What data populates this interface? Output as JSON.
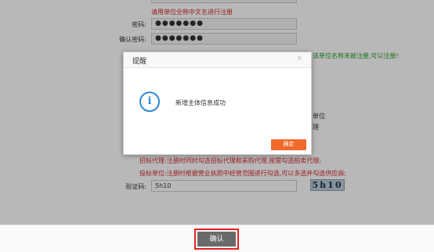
{
  "form": {
    "name_hint": "请用单位全称中文名进行注册",
    "password_label": "密码:",
    "password_value": "●●●●●●●",
    "confirm_password_label": "确认密码:",
    "confirm_password_value": "●●●●●●●",
    "name_status": "该单位名称未被注册,可以注册!",
    "partial_side_1": "单位",
    "partial_side_2": "理",
    "bidding_agent_note": "招标代理:注册时同时勾选招标代理和采购代理,按需勾选拍卖代理;",
    "bidding_unit_note": "投标单位:注册时根据营业执照中经营范围进行勾选,可以多选并勾选供应商;",
    "captcha_label": "验证码:",
    "captcha_value": "5h10",
    "captcha_image_text": "5h10",
    "submit_label": "确认"
  },
  "modal": {
    "title": "提醒",
    "close_glyph": "×",
    "icon_glyph": "i",
    "message": "新增主体信息成功",
    "ok_label": "确定"
  },
  "colors": {
    "accent": "#f06a2a",
    "info": "#2e8ad8",
    "error_red": "#d8292f",
    "success_green": "#2a9a22",
    "highlight_border": "#e2221c"
  }
}
